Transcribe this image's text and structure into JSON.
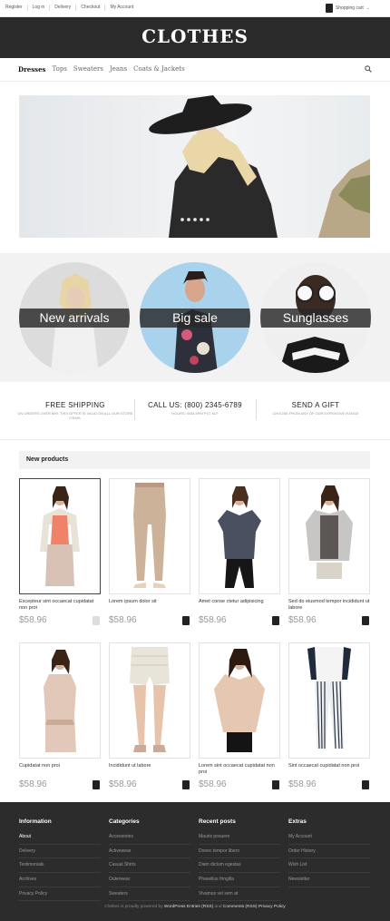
{
  "topbar": {
    "links": [
      "Register",
      "Log in",
      "Delivery",
      "Checkout",
      "My Account"
    ],
    "cart_label": "Shopping cart"
  },
  "header": {
    "logo": "CLOTHES"
  },
  "nav": {
    "items": [
      "Dresses",
      "Tops",
      "Sweaters",
      "Jeans",
      "Coats & Jackets"
    ]
  },
  "promos": [
    {
      "label": "New arrivals"
    },
    {
      "label": "Big sale"
    },
    {
      "label": "Sunglasses"
    }
  ],
  "features": [
    {
      "title": "FREE SHIPPING",
      "subtitle": "ON ORDERS OVER $99. THIS OFFER IS VALID ON ALL OUR STORE ITEMS."
    },
    {
      "title": "CALL US: (800) 2345-6789",
      "subtitle": "HOURS: 9AM-5PM PST M-F"
    },
    {
      "title": "SEND A GIFT",
      "subtitle": "CHOOSE FROM ANY OF OUR EXPENSIVE RANGE"
    }
  ],
  "new_products": {
    "heading": "New products",
    "items": [
      {
        "name": "Excepteur sint occaecat cupidatat non proi",
        "price": "$58.96"
      },
      {
        "name": "Lorem ipsum dolor sit",
        "price": "$58.96"
      },
      {
        "name": "Amet conse ctetur adipisicing",
        "price": "$58.96"
      },
      {
        "name": "Sed do eiusmod tempor incididunt ut labore",
        "price": "$58.96"
      },
      {
        "name": "Cupidatat non proi",
        "price": "$58.96"
      },
      {
        "name": "Incididunt ut labore",
        "price": "$58.96"
      },
      {
        "name": "Lorem sint occaecat cupidatat non proi",
        "price": "$58.96"
      },
      {
        "name": "Sint occaecat cupidatat non proi",
        "price": "$58.96"
      }
    ]
  },
  "footer": {
    "columns": [
      {
        "heading": "Information",
        "items": [
          "About",
          "Delivery",
          "Testimonials",
          "Archives",
          "Privacy Policy"
        ]
      },
      {
        "heading": "Categories",
        "items": [
          "Accessories",
          "Activewear",
          "Casual Shirts",
          "Outerwear",
          "Sweaters"
        ]
      },
      {
        "heading": "Recent posts",
        "items": [
          "Mauris posuere",
          "Donec tempor libero",
          "Diam dictum egestas",
          "Phasellus fringilla",
          "Vivamus vel sem at"
        ]
      },
      {
        "heading": "Extras",
        "items": [
          "My Account",
          "Order History",
          "Wish List",
          "Newsletter"
        ]
      }
    ],
    "copyright_prefix": "Clothes is proudly powered by",
    "link_entries": "WordPress Entries (RSS)",
    "and": "and",
    "link_comments": "Comments (RSS)",
    "link_privacy": "Privacy Policy"
  },
  "colors": {
    "header_bg": "#2a2a2a",
    "footer_bg": "#2c2c2c",
    "promo_bg": "#f2f2f2",
    "price": "#999999"
  }
}
